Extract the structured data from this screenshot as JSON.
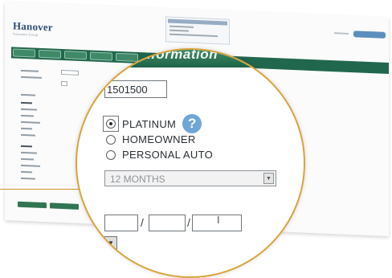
{
  "brand": {
    "name": "Hanover",
    "tagline": "Insurance Group"
  },
  "section": {
    "title": "Information"
  },
  "form": {
    "policy_number": "1501500",
    "options": [
      {
        "label": "PLATINUM",
        "checked": true
      },
      {
        "label": "HOMEOWNER",
        "checked": false
      },
      {
        "label": "PERSONAL AUTO",
        "checked": false
      }
    ],
    "term": "12 MONTHS",
    "date_separator": "/"
  },
  "icons": {
    "help": "question-mark-icon",
    "text_cursor": "text-cursor-icon",
    "dropdown": "chevron-down-icon"
  },
  "glyphs": {
    "help": "?",
    "cursor": "I",
    "arrow": "▼"
  },
  "colors": {
    "nav_green": "#0f5b3e",
    "accent_gold": "#d9a53c",
    "help_blue": "#6ea6d6"
  }
}
